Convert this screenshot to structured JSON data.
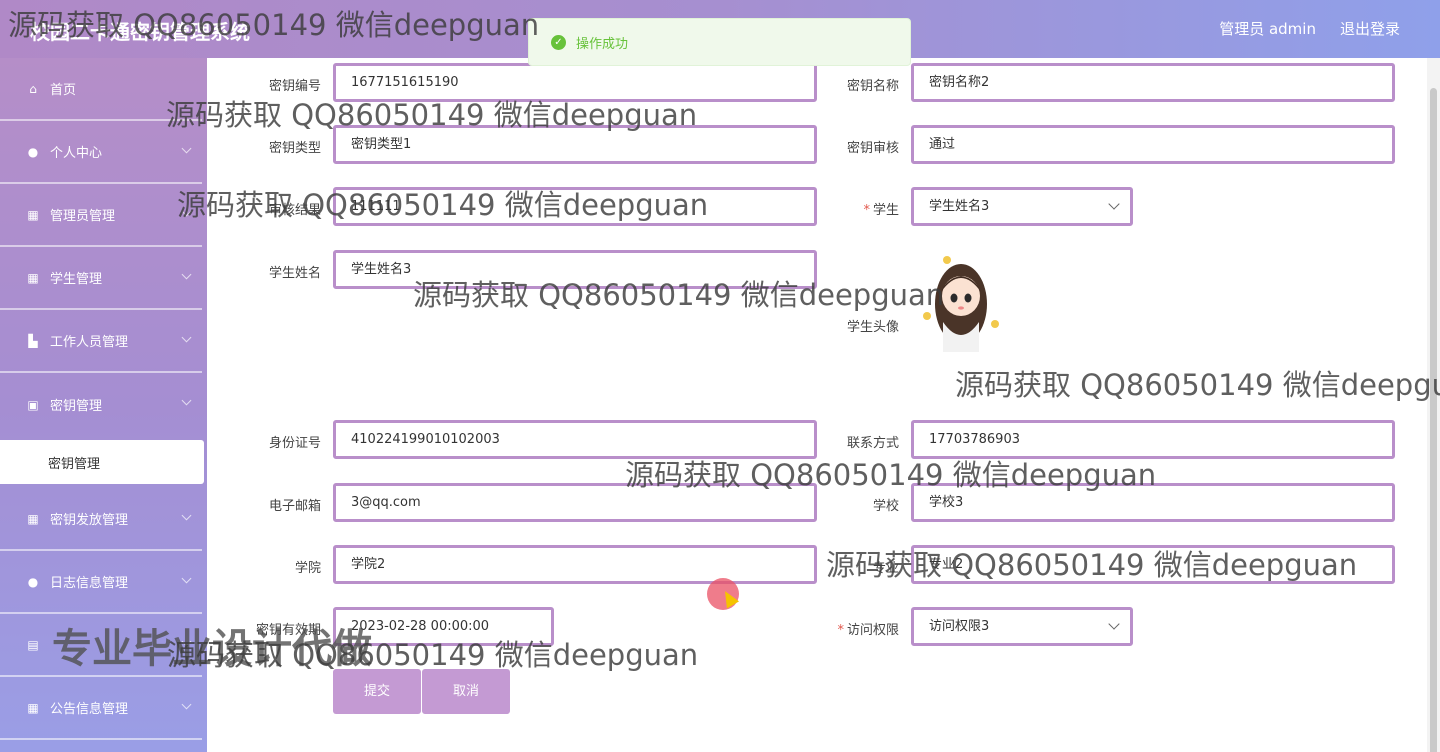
{
  "header": {
    "app_title": "校园二卡通密钥管理系统",
    "admin_label": "管理员 admin",
    "logout_label": "退出登录",
    "gradient_colors": [
      "#b089c7",
      "#8fa0ea"
    ]
  },
  "toast": {
    "message": "操作成功"
  },
  "sidebar": {
    "items": [
      {
        "label": "首页",
        "icon": "home-icon",
        "glyph": "⌂"
      },
      {
        "label": "个人中心",
        "icon": "person-icon",
        "glyph": "●"
      },
      {
        "label": "管理员管理",
        "icon": "grid-icon",
        "glyph": "▦"
      },
      {
        "label": "学生管理",
        "icon": "grid-icon",
        "glyph": "▦"
      },
      {
        "label": "工作人员管理",
        "icon": "users-icon",
        "glyph": "▙"
      },
      {
        "label": "密钥管理",
        "icon": "key-icon",
        "glyph": "▣"
      },
      {
        "label": "密钥管理",
        "sub": true
      },
      {
        "label": "密钥发放管理",
        "icon": "grid-icon",
        "glyph": "▦"
      },
      {
        "label": "日志信息管理",
        "icon": "person-icon",
        "glyph": "●"
      },
      {
        "label": "",
        "icon": "doc-icon",
        "glyph": "▤"
      },
      {
        "label": "公告信息管理",
        "icon": "grid-icon",
        "glyph": "▦"
      }
    ]
  },
  "form": {
    "key_no": {
      "label": "密钥编号",
      "value": "1677151615190"
    },
    "key_name": {
      "label": "密钥名称",
      "value": "密钥名称2"
    },
    "key_type": {
      "label": "密钥类型",
      "value": "密钥类型1"
    },
    "key_review": {
      "label": "密钥审核",
      "value": "通过"
    },
    "review_result": {
      "label": "审核结果",
      "value": "111111"
    },
    "student": {
      "label": "学生",
      "value": "学生姓名3"
    },
    "student_name": {
      "label": "学生姓名",
      "value": "学生姓名3"
    },
    "student_avatar": {
      "label": "学生头像"
    },
    "id_no": {
      "label": "身份证号",
      "value": "410224199010102003"
    },
    "contact": {
      "label": "联系方式",
      "value": "17703786903"
    },
    "email": {
      "label": "电子邮箱",
      "value": "3@qq.com"
    },
    "school": {
      "label": "学校",
      "value": "学校3"
    },
    "college": {
      "label": "学院",
      "value": "学院2"
    },
    "major": {
      "label": "专业",
      "value": "专业2"
    },
    "valid_until": {
      "label": "密钥有效期",
      "value": "2023-02-28 00:00:00"
    },
    "access": {
      "label": "访问权限",
      "value": "访问权限3"
    },
    "submit_label": "提交",
    "cancel_label": "取消"
  },
  "watermarks": {
    "text": "源码获取 QQ86050149 微信deepguan",
    "partial": "源码获取 QQ86050149 微信deepgu",
    "big": "专业毕业设计代做"
  }
}
